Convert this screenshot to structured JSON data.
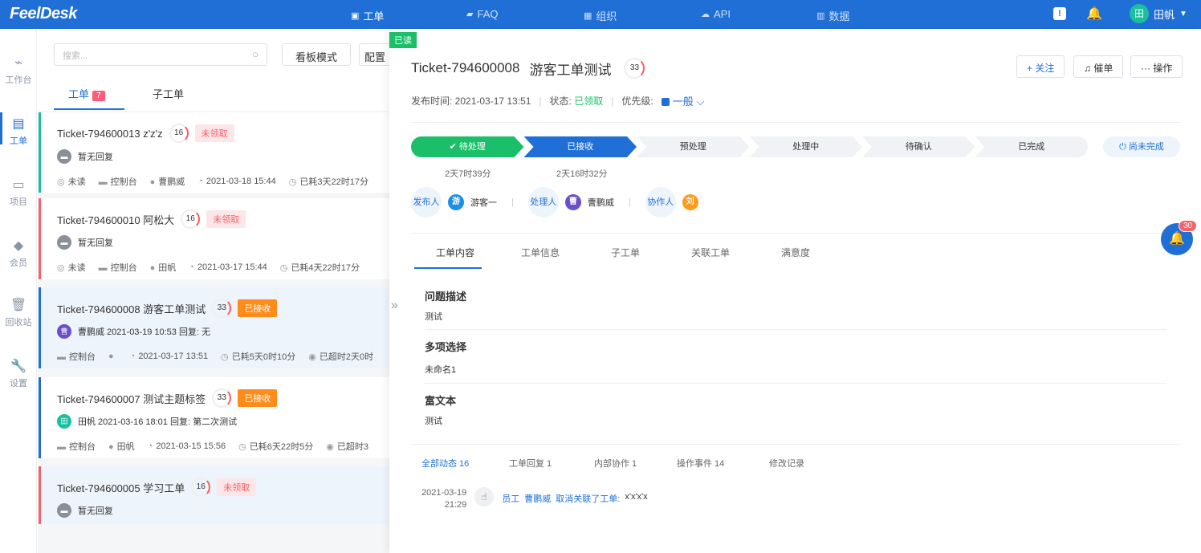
{
  "app": {
    "logo": "FeelDesk"
  },
  "nav": [
    {
      "label": "工单",
      "icon": "ticket-icon"
    },
    {
      "label": "FAQ",
      "icon": "faq-icon"
    },
    {
      "label": "组织",
      "icon": "org-icon"
    },
    {
      "label": "API",
      "icon": "api-icon"
    },
    {
      "label": "数据",
      "icon": "chart-icon"
    }
  ],
  "topbar": {
    "user_name": "田帆",
    "user_initial": "田"
  },
  "sidebar": [
    {
      "label": "工作台"
    },
    {
      "label": "工单"
    },
    {
      "label": "项目"
    },
    {
      "label": "会员"
    },
    {
      "label": "回收站"
    },
    {
      "label": "设置"
    }
  ],
  "list": {
    "search_placeholder": "搜索...",
    "kanban_btn": "看板模式",
    "config_btn": "配置",
    "tabs": [
      {
        "label": "工单",
        "count": "7"
      },
      {
        "label": "子工单"
      }
    ],
    "cards": [
      {
        "title": "Ticket-794600013 z'z'z",
        "score": "16",
        "tag": "未领取",
        "reply": "暂无回复",
        "meta": [
          "未读",
          "控制台",
          "曹鹏威",
          "2021-03-18 15:44",
          "已耗3天22时17分"
        ]
      },
      {
        "title": "Ticket-794600010 阿松大",
        "score": "16",
        "tag": "未领取",
        "reply": "暂无回复",
        "meta": [
          "未读",
          "控制台",
          "田帆",
          "2021-03-17 15:44",
          "已耗4天22时17分"
        ]
      },
      {
        "title": "Ticket-794600008 游客工单测试",
        "score": "33",
        "tag": "已接收",
        "avatar": "曹",
        "reply": "曹鹏威 2021-03-19 10:53 回复: 无",
        "meta": [
          "控制台",
          "",
          "2021-03-17 13:51",
          "已耗5天0时10分",
          "已超时2天0时"
        ]
      },
      {
        "title": "Ticket-794600007 测试主题标签",
        "score": "33",
        "tag": "已接收",
        "avatar": "田",
        "reply": "田帆 2021-03-16 18:01 回复: 第二次测试",
        "meta": [
          "控制台",
          "田帆",
          "2021-03-15 15:56",
          "已耗6天22时5分",
          "已超时3"
        ]
      },
      {
        "title": "Ticket-794600005 学习工单",
        "score": "16",
        "tag": "未领取",
        "reply": "暂无回复"
      }
    ]
  },
  "detail": {
    "read_flag": "已读",
    "title": "Ticket-794600008",
    "subject": "游客工单测试",
    "score": "33",
    "follow_btn": "+ 关注",
    "urge_btn": "催单",
    "ops_btn": "··· 操作",
    "publish_label": "发布时间: 2021-03-17 13:51",
    "status_label": "状态:",
    "status_value": "已领取",
    "priority_label": "优先级:",
    "priority_value": "一般",
    "steps": [
      "待处理",
      "已接收",
      "预处理",
      "处理中",
      "待确认",
      "已完成"
    ],
    "unfinished": "尚未完成",
    "step_times": [
      "2天7时39分",
      "2天16时32分"
    ],
    "people": {
      "publisher_label": "发布人",
      "publisher_initial": "游",
      "publisher": "游客一",
      "handler_label": "处理人",
      "handler_initial": "曹",
      "handler": "曹鹏威",
      "collab_label": "协作人",
      "collab_initial": "刘"
    },
    "tabs": [
      "工单内容",
      "工单信息",
      "子工单",
      "关联工单",
      "满意度"
    ],
    "sections": [
      {
        "title": "问题描述",
        "value": "测试"
      },
      {
        "title": "多项选择",
        "value": "未命名1"
      },
      {
        "title": "富文本",
        "value": "测试"
      }
    ],
    "activity_tabs": [
      "全部动态 16",
      "工单回复 1",
      "内部协作 1",
      "操作事件 14",
      "修改记录"
    ],
    "activity": {
      "date": "2021-03-19",
      "time": "21:29",
      "role": "员工",
      "user": "曹鹏威",
      "action": "取消关联了工单:",
      "target": "x'x'x'x"
    }
  },
  "notif_count": "30",
  "colors": {
    "brand": "#1f6fd6",
    "success": "#1bbf6a",
    "danger": "#f5616a",
    "warning": "#ff8c1a"
  }
}
